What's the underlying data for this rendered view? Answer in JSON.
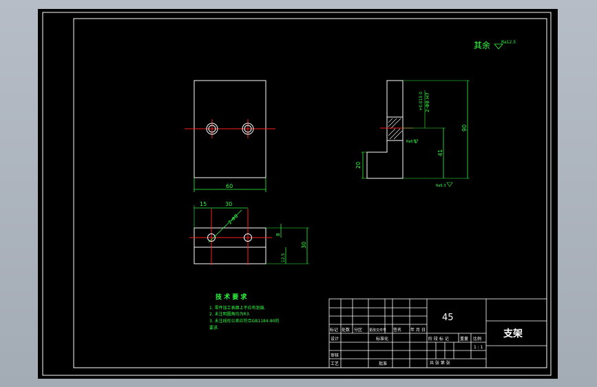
{
  "drawing": {
    "title": "支架",
    "material": "45",
    "roughness_note": "其余",
    "roughness_value": "Ra12.5",
    "technical_requirements": {
      "heading": "技 术 要 求",
      "items": [
        "1. 零件加工表面上不应有划痕.",
        "2. 未注明圆角均为R3.",
        "3. 未注线形公差应符合GB1184-80的",
        "要求."
      ]
    }
  },
  "dimensions": {
    "front_width": "60",
    "side_height": "90",
    "side_step_height": "41",
    "side_step_width": "20",
    "hole_fit": "2-Φ8 H7",
    "hole_tolerance": "+0.015 0",
    "top_offset_15": "15",
    "top_spacing_30": "30",
    "top_hole_dia": "2-Φ8",
    "top_height_8": "8",
    "top_total_30": "30",
    "top_12_5": "12.5",
    "surface_finish_1": "Ra6.3",
    "surface_finish_2": "Ra6.3"
  },
  "title_block": {
    "row_labels": [
      "标记",
      "处数",
      "分区",
      "更改文件号",
      "签名",
      "年 月 日"
    ],
    "designer": "设计",
    "standardization": "标准化",
    "review": "审核",
    "process": "工艺",
    "approve": "批准",
    "stage_labels": [
      "阶 段 标 记",
      "重量",
      "比例"
    ],
    "scale": "1 : 1",
    "sheet_label": "共    张  第    张"
  }
}
